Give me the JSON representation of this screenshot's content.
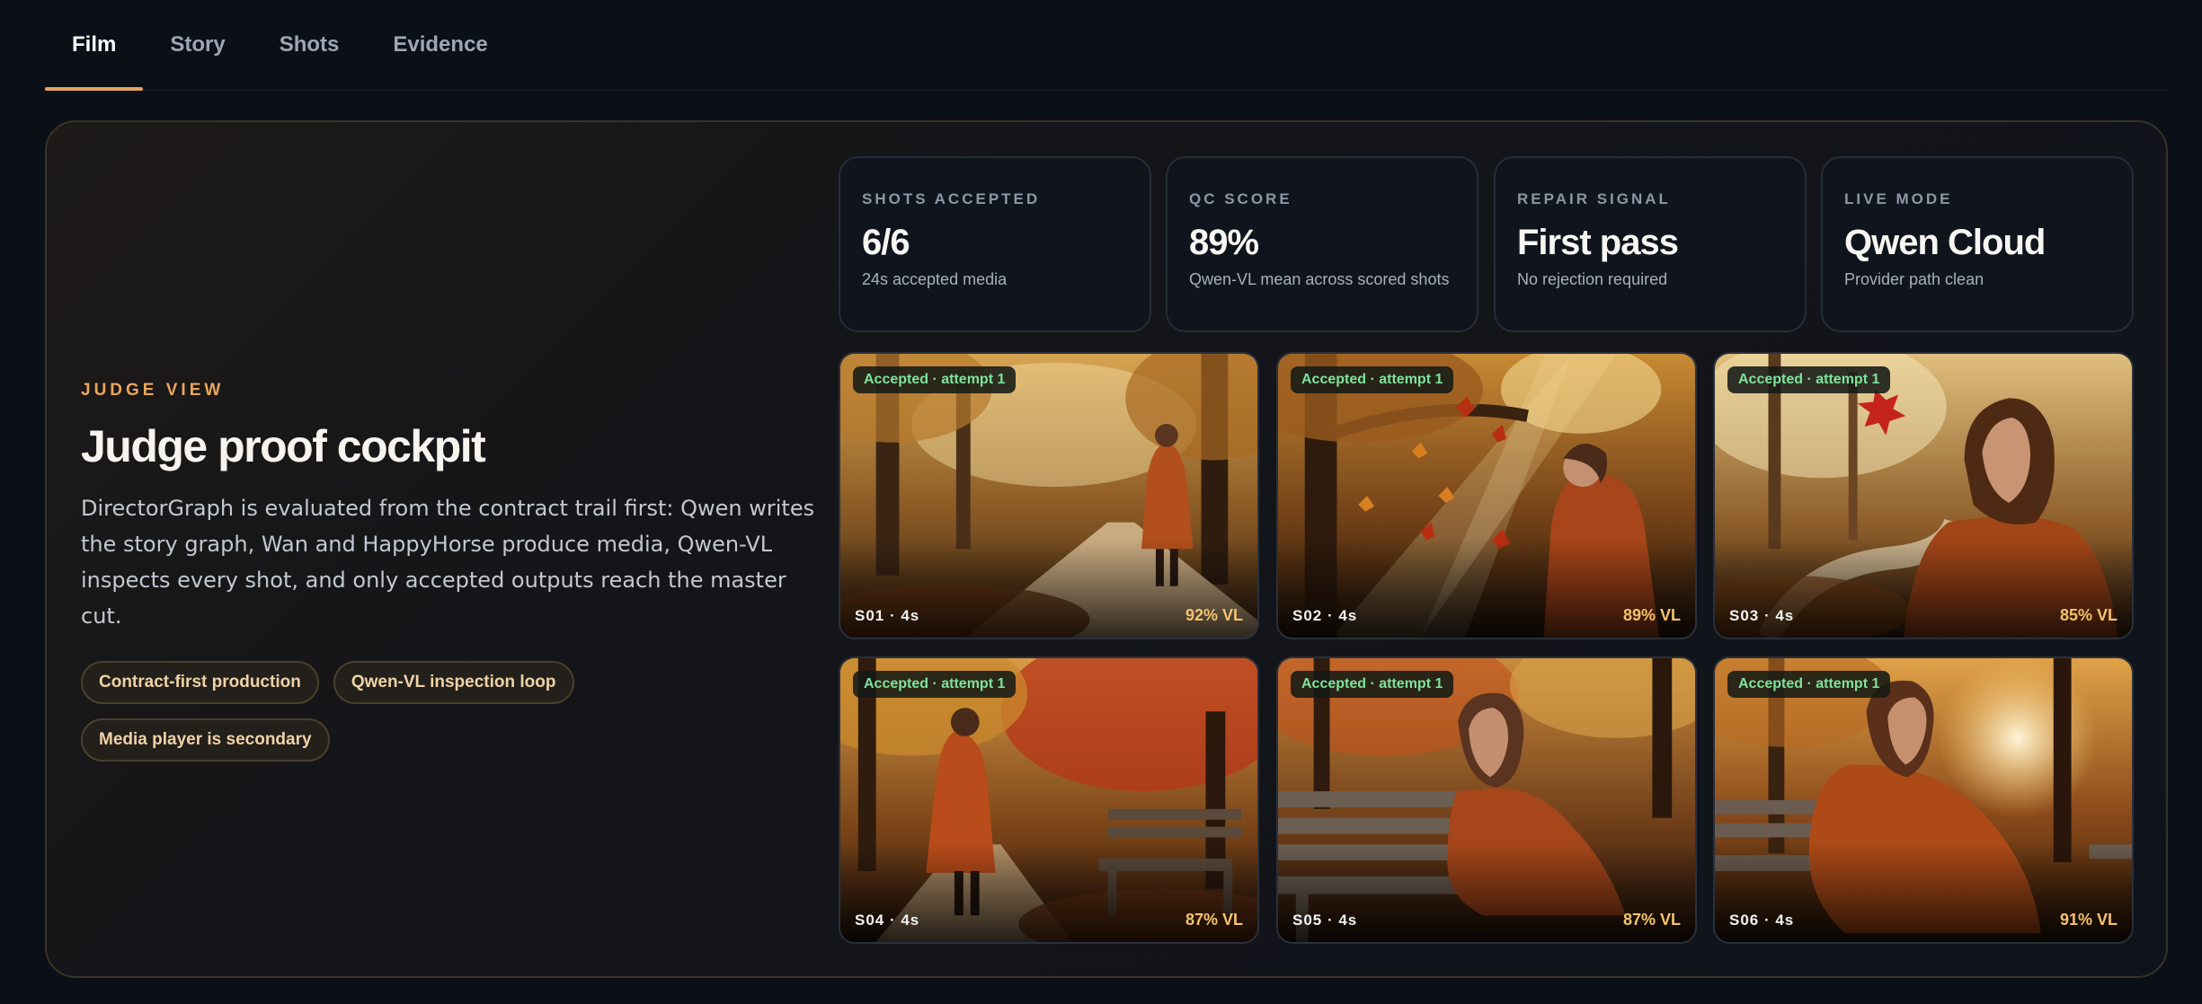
{
  "tabs": [
    {
      "label": "Film",
      "active": true
    },
    {
      "label": "Story",
      "active": false
    },
    {
      "label": "Shots",
      "active": false
    },
    {
      "label": "Evidence",
      "active": false
    }
  ],
  "intro": {
    "eyebrow": "JUDGE VIEW",
    "title": "Judge proof cockpit",
    "description": "DirectorGraph is evaluated from the contract trail first: Qwen writes the story graph, Wan and HappyHorse produce media, Qwen-VL inspects every shot, and only accepted outputs reach the master cut.",
    "chips": [
      "Contract-first production",
      "Qwen-VL inspection loop",
      "Media player is secondary"
    ]
  },
  "stats": [
    {
      "label": "SHOTS ACCEPTED",
      "value": "6/6",
      "sub": "24s accepted media"
    },
    {
      "label": "QC SCORE",
      "value": "89%",
      "sub": "Qwen-VL mean across scored shots"
    },
    {
      "label": "REPAIR SIGNAL",
      "value": "First pass",
      "sub": "No rejection required"
    },
    {
      "label": "LIVE MODE",
      "value": "Qwen Cloud",
      "sub": "Provider path clean"
    }
  ],
  "shots": [
    {
      "status": "Accepted · attempt 1",
      "id": "S01 · 4s",
      "score": "92% VL"
    },
    {
      "status": "Accepted · attempt 1",
      "id": "S02 · 4s",
      "score": "89% VL"
    },
    {
      "status": "Accepted · attempt 1",
      "id": "S03 · 4s",
      "score": "85% VL"
    },
    {
      "status": "Accepted · attempt 1",
      "id": "S04 · 4s",
      "score": "87% VL"
    },
    {
      "status": "Accepted · attempt 1",
      "id": "S05 · 4s",
      "score": "87% VL"
    },
    {
      "status": "Accepted · attempt 1",
      "id": "S06 · 4s",
      "score": "91% VL"
    }
  ],
  "colors": {
    "accent": "#e7a65a",
    "accepted": "#7fe39a",
    "score": "#f4c36d",
    "background": "#0b0f17"
  }
}
